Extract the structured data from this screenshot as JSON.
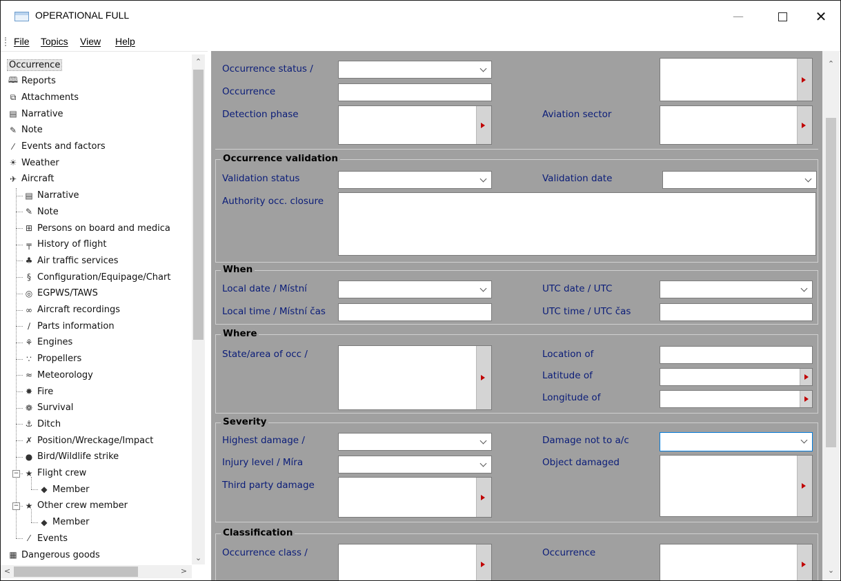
{
  "window": {
    "title": "OPERATIONAL FULL"
  },
  "menu": {
    "items": [
      "File",
      "Topics",
      "View",
      "Help"
    ]
  },
  "tree": {
    "selected": "Occurrence",
    "nodes": [
      {
        "label": "Occurrence",
        "icon": "none",
        "level": 0
      },
      {
        "label": "Reports",
        "icon": "report-icon",
        "level": 0
      },
      {
        "label": "Attachments",
        "icon": "attachment-icon",
        "level": 0
      },
      {
        "label": "Narrative",
        "icon": "narrative-icon",
        "level": 0
      },
      {
        "label": "Note",
        "icon": "note-icon",
        "level": 0
      },
      {
        "label": "Events and factors",
        "icon": "events-icon",
        "level": 0
      },
      {
        "label": "Weather",
        "icon": "weather-icon",
        "level": 0
      },
      {
        "label": "Aircraft",
        "icon": "aircraft-icon",
        "level": 0
      },
      {
        "label": "Narrative",
        "icon": "narrative-icon",
        "level": 1
      },
      {
        "label": "Note",
        "icon": "note-icon",
        "level": 1
      },
      {
        "label": "Persons on board and medica",
        "icon": "medical-icon",
        "level": 1
      },
      {
        "label": "History of flight",
        "icon": "history-icon",
        "level": 1
      },
      {
        "label": "Air traffic services",
        "icon": "atc-icon",
        "level": 1
      },
      {
        "label": "Configuration/Equipage/Chart",
        "icon": "configuration-icon",
        "level": 1
      },
      {
        "label": "EGPWS/TAWS",
        "icon": "egpws-icon",
        "level": 1
      },
      {
        "label": "Aircraft recordings",
        "icon": "recording-icon",
        "level": 1
      },
      {
        "label": "Parts information",
        "icon": "parts-icon",
        "level": 1
      },
      {
        "label": "Engines",
        "icon": "engine-icon",
        "level": 1
      },
      {
        "label": "Propellers",
        "icon": "propeller-icon",
        "level": 1
      },
      {
        "label": "Meteorology",
        "icon": "meteorology-icon",
        "level": 1
      },
      {
        "label": "Fire",
        "icon": "fire-icon",
        "level": 1
      },
      {
        "label": "Survival",
        "icon": "survival-icon",
        "level": 1
      },
      {
        "label": "Ditch",
        "icon": "ditch-icon",
        "level": 1
      },
      {
        "label": "Position/Wreckage/Impact",
        "icon": "wreckage-icon",
        "level": 1
      },
      {
        "label": "Bird/Wildlife strike",
        "icon": "bird-icon",
        "level": 1
      },
      {
        "label": "Flight crew",
        "icon": "crew-icon",
        "level": 1
      },
      {
        "label": "Member",
        "icon": "member-icon",
        "level": 2
      },
      {
        "label": "Other crew member",
        "icon": "crew-icon",
        "level": 1
      },
      {
        "label": "Member",
        "icon": "member-icon",
        "level": 2
      },
      {
        "label": "Events",
        "icon": "events-icon",
        "level": 1
      },
      {
        "label": "Dangerous goods",
        "icon": "dangerous-goods-icon",
        "level": 0
      }
    ]
  },
  "form": {
    "top": {
      "occurrence_status": "Occurrence status /",
      "occurrence": "Occurrence",
      "detection_phase": "Detection phase",
      "aviation_sector": "Aviation sector"
    },
    "validation": {
      "title": "Occurrence validation",
      "status": "Validation status",
      "date": "Validation date",
      "closure": "Authority occ. closure"
    },
    "when": {
      "title": "When",
      "local_date": "Local date / Místní",
      "utc_date": "UTC date / UTC",
      "local_time": "Local time / Místní čas",
      "utc_time": "UTC time / UTC čas"
    },
    "where": {
      "title": "Where",
      "state": "State/area of occ /",
      "location": "Location of",
      "latitude": "Latitude of",
      "longitude": "Longitude of"
    },
    "severity": {
      "title": "Severity",
      "highest_damage": "Highest damage /",
      "damage_not_ac": "Damage not to a/c",
      "injury_level": "Injury level / Míra",
      "object_damaged": "Object damaged",
      "third_party": "Third party damage"
    },
    "classification": {
      "title": "Classification",
      "occurrence_class": "Occurrence class /",
      "occurrence": "Occurrence"
    }
  }
}
